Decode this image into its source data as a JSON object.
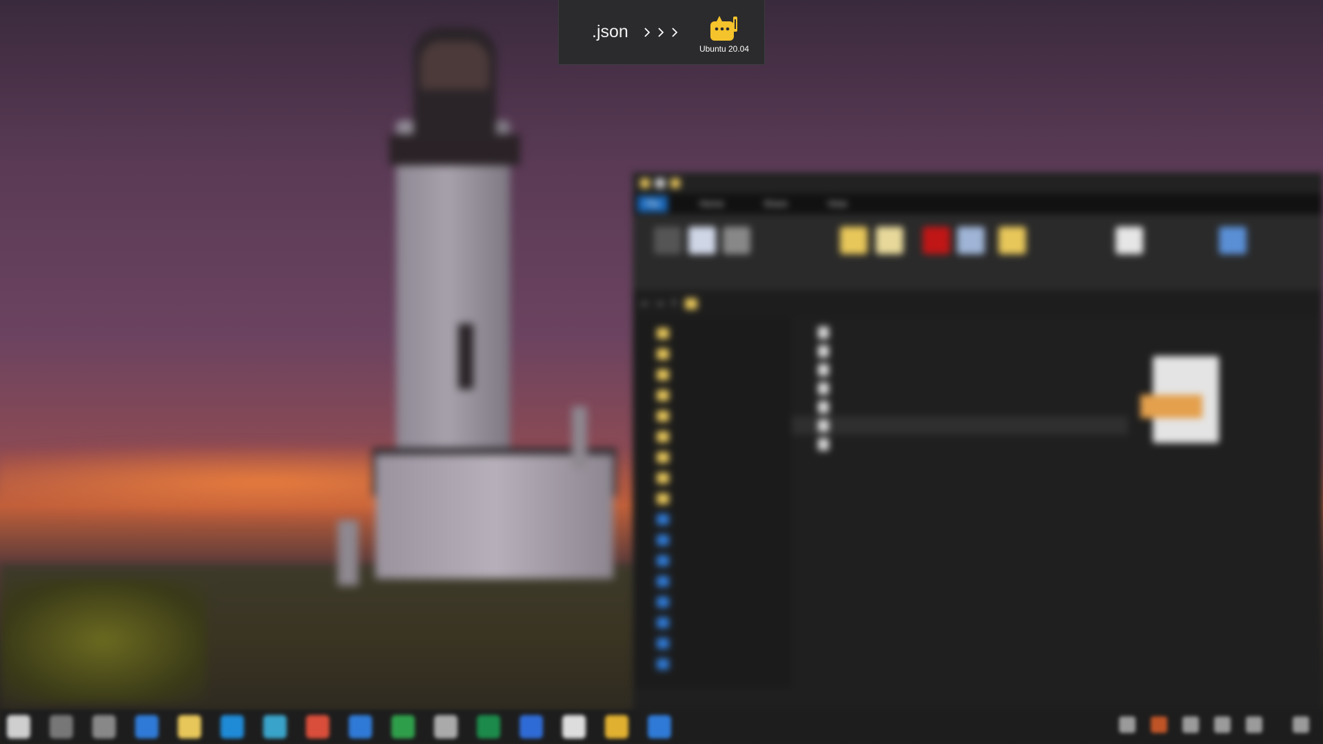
{
  "overlay": {
    "label": ".json",
    "arrow_icons": [
      "chevron-right-icon",
      "chevron-right-icon",
      "chevron-right-icon"
    ],
    "app": {
      "name": "Ubuntu 20.04",
      "icon": "tux-penguin-icon",
      "icon_color": "#f5c32c"
    }
  },
  "explorer": {
    "title": "",
    "menu_tabs": [
      "File",
      "Home",
      "Share",
      "View"
    ],
    "address_path": [
      "",
      ""
    ],
    "nav_items": [
      "",
      "",
      "",
      "",
      "",
      "",
      "",
      "",
      "",
      "",
      "",
      "",
      "",
      "",
      "",
      "",
      ""
    ],
    "files": [
      {
        "name": "",
        "date": ""
      },
      {
        "name": "",
        "date": ""
      },
      {
        "name": "",
        "date": ""
      },
      {
        "name": "",
        "date": ""
      },
      {
        "name": "",
        "date": ""
      },
      {
        "name": "",
        "date": ""
      },
      {
        "name": "",
        "date": ""
      }
    ],
    "selected_file_index": 5,
    "accent_color": "#1a67b8"
  },
  "taskbar": {
    "items": [
      "windows-start-icon",
      "search-icon",
      "task-view-icon",
      "explorer-icon",
      "file-folder-icon",
      "vscode-icon",
      "edge-icon",
      "app-icon",
      "mail-icon",
      "excel-icon",
      "app-icon",
      "xbox-icon",
      "word-icon",
      "app-icon",
      "chrome-icon",
      "terminal-icon"
    ],
    "tray_clock": ""
  }
}
